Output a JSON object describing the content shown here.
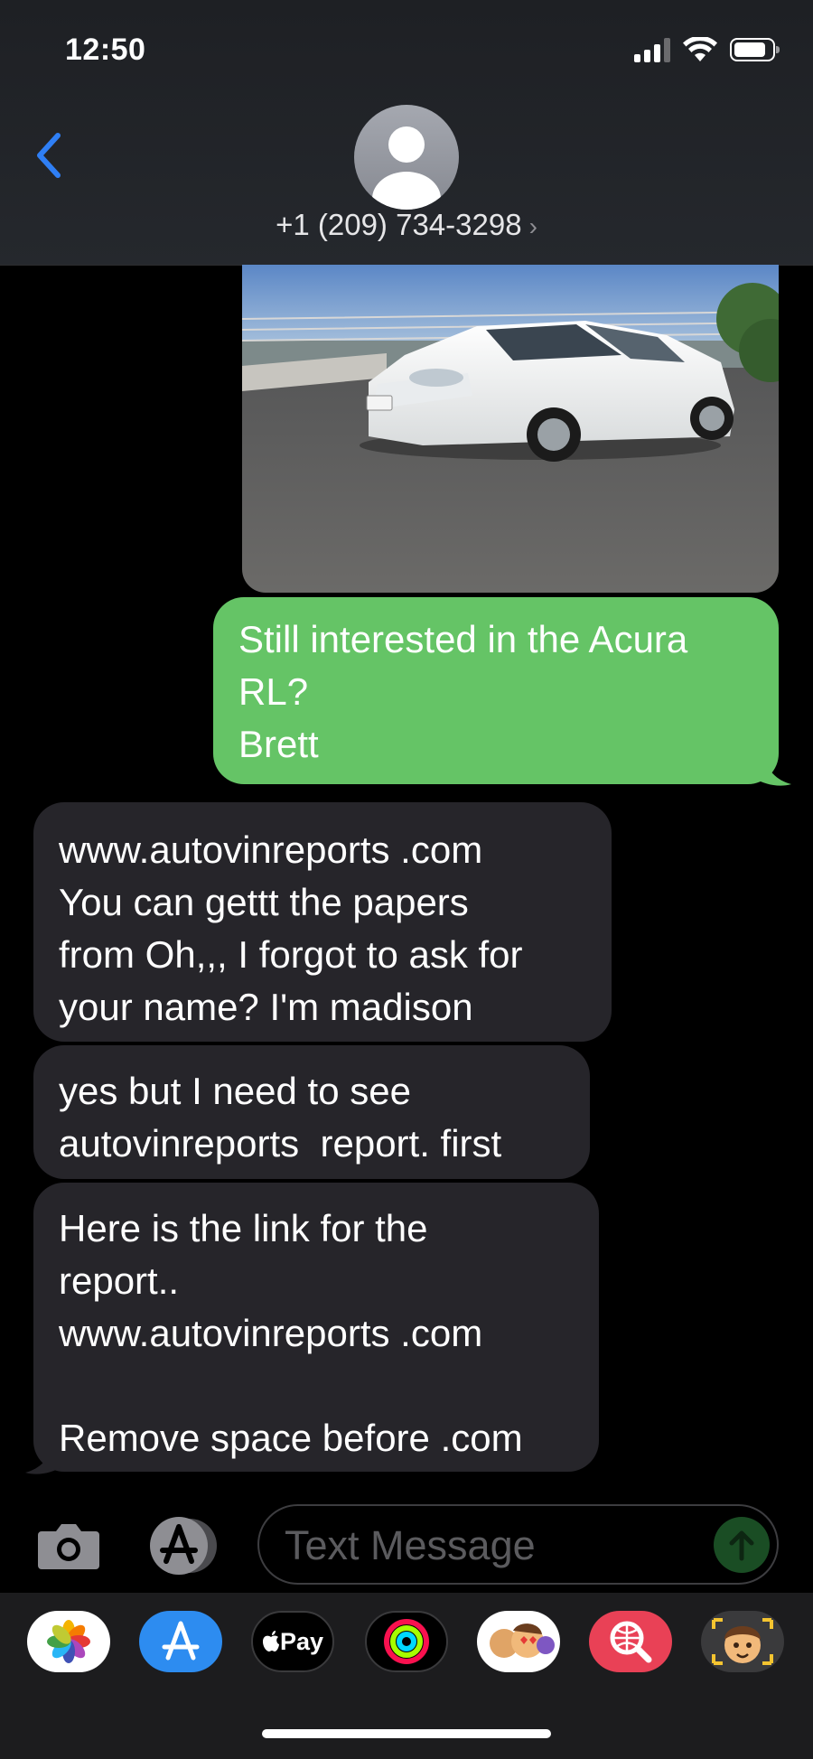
{
  "status_bar": {
    "time": "12:50"
  },
  "header": {
    "contact": "+1 (209) 734-3298",
    "contact_chevron": "›",
    "back_icon": "chevron-left-icon"
  },
  "messages": [
    {
      "type": "image",
      "direction": "sent",
      "description_icon": "car-photo"
    },
    {
      "type": "text",
      "direction": "sent",
      "lines": [
        "Still interested in the Acura",
        "RL?",
        "Brett"
      ]
    },
    {
      "type": "text",
      "direction": "received",
      "lines": [
        "www.autovinreports .com",
        "You can gettt the papers",
        "from Oh,,, I forgot to ask for",
        "your name? I'm madison"
      ]
    },
    {
      "type": "text",
      "direction": "received",
      "lines": [
        "yes but I need to see",
        "autovinreports  report. first"
      ]
    },
    {
      "type": "text",
      "direction": "received",
      "lines": [
        "Here is the link for the",
        "report..",
        "www.autovinreports .com",
        "",
        "Remove space before .com"
      ]
    }
  ],
  "input_bar": {
    "placeholder": "Text Message"
  },
  "app_drawer": {
    "items": [
      "photos-icon",
      "app-store-icon",
      "apple-pay-icon",
      "activity-icon",
      "memoji-stickers-icon",
      "image-search-icon",
      "memoji-icon"
    ],
    "apple_pay_label": "Pay"
  },
  "colors": {
    "sent_bubble": "#65c466",
    "received_bubble": "#26252a",
    "accent": "#2f7ff5"
  }
}
